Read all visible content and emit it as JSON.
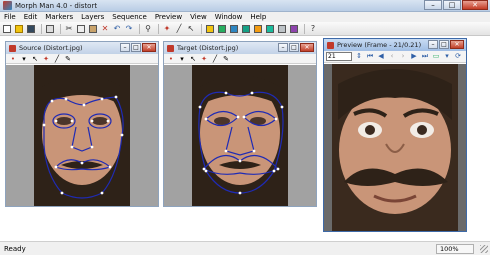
{
  "app": {
    "title": "Morph Man 4.0 - distort"
  },
  "window_controls": {
    "minimize": "–",
    "maximize": "□",
    "close": "✕"
  },
  "menu": [
    "File",
    "Edit",
    "Markers",
    "Layers",
    "Sequence",
    "Preview",
    "View",
    "Window",
    "Help"
  ],
  "toolbar_icons": [
    "new-icon",
    "open-icon",
    "save-icon",
    "print-icon",
    "cut-icon",
    "copy-icon",
    "paste-icon",
    "delete-icon",
    "undo-icon",
    "redo-icon",
    "zoom-icon",
    "marker-icon",
    "curve-icon",
    "arrow-icon",
    "layer1-icon",
    "layer2-icon",
    "layer3-icon",
    "layer4-icon",
    "layer5-icon",
    "layer6-icon",
    "layer7-icon",
    "layer8-icon",
    "help-icon"
  ],
  "panels": {
    "source": {
      "title": "Source (Distort.jpg)",
      "tools": [
        "•",
        "▾",
        "↖",
        "✦",
        "╱",
        "✎"
      ]
    },
    "target": {
      "title": "Target (Distort.jpg)",
      "tools": [
        "•",
        "▾",
        "↖",
        "✦",
        "╱",
        "✎"
      ]
    },
    "preview": {
      "title": "Preview (Frame - 21/0.21)",
      "frame": "21"
    }
  },
  "status": {
    "text": "Ready",
    "zoom": "100%"
  },
  "colors": {
    "marker_line": "#1f2bb5",
    "marker_point": "#ffffff",
    "hair": "#2e2218",
    "skin": "#c99578",
    "canvas_bg": "#a2a2a2"
  }
}
